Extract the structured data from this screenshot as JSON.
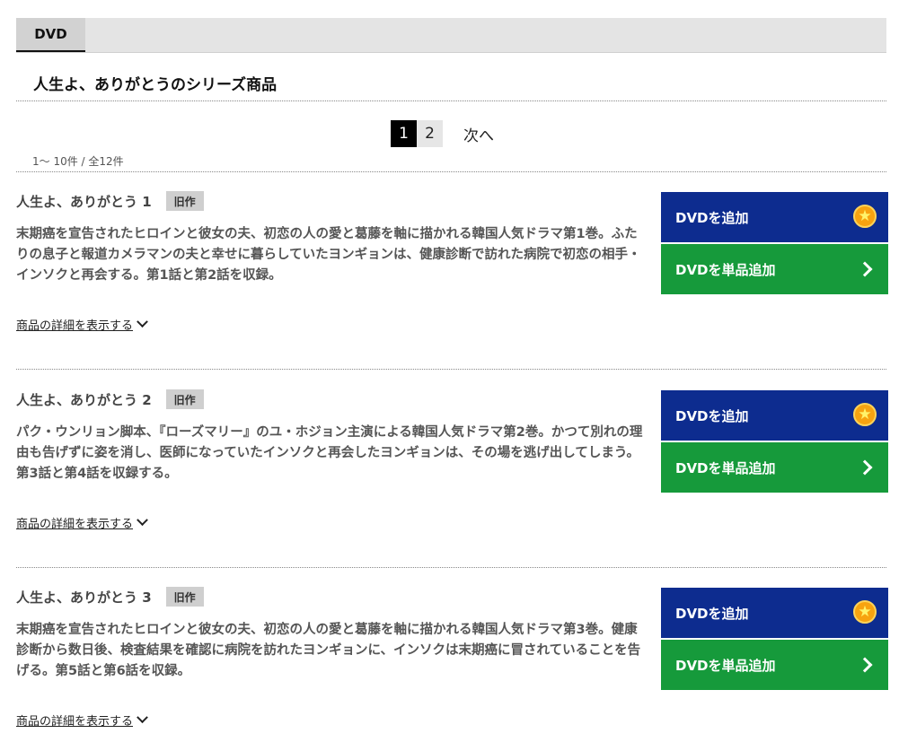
{
  "tabs": {
    "active": "DVD"
  },
  "series_title": "人生よ、ありがとうのシリーズ商品",
  "pagination": {
    "current": "1",
    "pages": [
      "2"
    ],
    "next": "次へ"
  },
  "range_text": "1～ 10件 / 全12件",
  "common": {
    "add_label": "DVDを追加",
    "add_single_label": "DVDを単品追加",
    "detail_label": "商品の詳細を表示する"
  },
  "items": [
    {
      "title": "人生よ、ありがとう 1",
      "badge": "旧作",
      "description": "末期癌を宣告されたヒロインと彼女の夫、初恋の人の愛と葛藤を軸に描かれる韓国人気ドラマ第1巻。ふたりの息子と報道カメラマンの夫と幸せに暮らしていたヨンギョンは、健康診断で訪れた病院で初恋の相手・インソクと再会する。第1話と第2話を収録。"
    },
    {
      "title": "人生よ、ありがとう 2",
      "badge": "旧作",
      "description": "パク・ウンリョン脚本、『ローズマリー』のユ・ホジョン主演による韓国人気ドラマ第2巻。かつて別れの理由も告げずに姿を消し、医師になっていたインソクと再会したヨンギョンは、その場を逃げ出してしまう。第3話と第4話を収録する。"
    },
    {
      "title": "人生よ、ありがとう 3",
      "badge": "旧作",
      "description": "末期癌を宣告されたヒロインと彼女の夫、初恋の人の愛と葛藤を軸に描かれる韓国人気ドラマ第3巻。健康診断から数日後、検査結果を確認に病院を訪れたヨンギョンに、インソクは末期癌に冒されていることを告げる。第5話と第6話を収録。"
    }
  ],
  "colors": {
    "add_button": "#0d2c8f",
    "single_button": "#169a3b",
    "star": "#f7a310"
  }
}
